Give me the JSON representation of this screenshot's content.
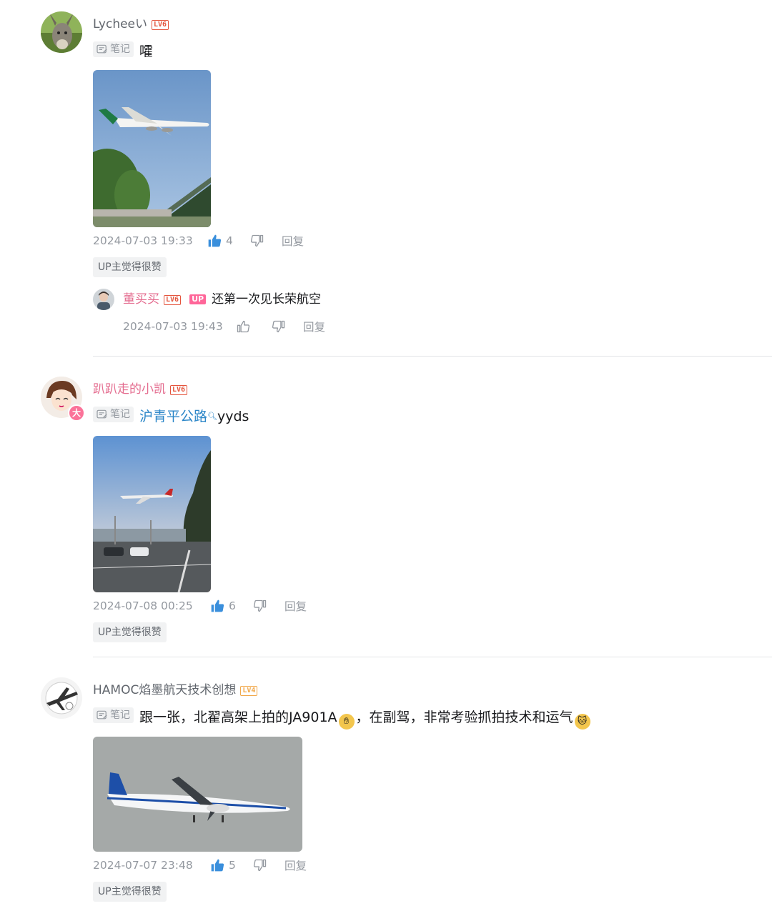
{
  "comments": [
    {
      "username": "Lycheeい",
      "level": "LV6",
      "note_tag": "笔记",
      "text": "嚯",
      "date": "2024-07-03 19:33",
      "likes": "4",
      "reply_label": "回复",
      "up_badge": "UP主觉得很赞",
      "replies": [
        {
          "username": "董买买",
          "level": "LV6",
          "up_tag": "UP",
          "text": "还第一次见长荣航空",
          "date": "2024-07-03 19:43",
          "reply_label": "回复"
        }
      ]
    },
    {
      "username": "趴趴走的小凯",
      "level": "LV6",
      "avatar_badge": "大",
      "note_tag": "笔记",
      "link_text": "沪青平公路",
      "text": "yyds",
      "date": "2024-07-08 00:25",
      "likes": "6",
      "reply_label": "回复",
      "up_badge": "UP主觉得很赞"
    },
    {
      "username": "HAMOC焰墨航天技术创想",
      "level": "LV4",
      "note_tag": "笔记",
      "text_part1": "跟一张，北翟高架上拍的JA901A",
      "text_part2": "，在副驾，非常考验抓拍技术和运气",
      "date": "2024-07-07 23:48",
      "likes": "5",
      "reply_label": "回复",
      "up_badge": "UP主觉得很赞"
    }
  ],
  "colors": {
    "link": "#2b86c8",
    "pink_name": "#e46c8f",
    "like_blue": "#3a8fdc",
    "meta_grey": "#9499a0"
  }
}
